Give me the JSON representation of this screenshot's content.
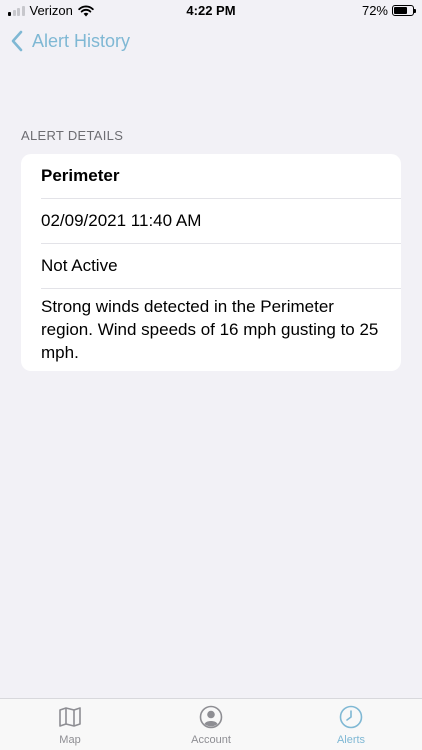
{
  "status_bar": {
    "carrier": "Verizon",
    "time": "4:22 PM",
    "battery_percent": "72%",
    "battery_level": 0.72,
    "signal_bars_active": 1,
    "signal_bars_total": 4
  },
  "nav": {
    "back_label": "Alert History",
    "back_icon": "chevron-left-icon"
  },
  "section": {
    "header": "ALERT DETAILS"
  },
  "alert": {
    "name": "Perimeter",
    "datetime": "02/09/2021 11:40 AM",
    "status": "Not Active",
    "description": "Strong winds detected in the Perimeter region. Wind speeds of 16 mph gusting to 25 mph."
  },
  "tabs": [
    {
      "label": "Map",
      "icon": "map-icon",
      "active": false
    },
    {
      "label": "Account",
      "icon": "account-icon",
      "active": false
    },
    {
      "label": "Alerts",
      "icon": "clock-icon",
      "active": true
    }
  ],
  "colors": {
    "accent": "#7fb8d4",
    "background": "#f2f1f6",
    "inactive_tab": "#8e8e93"
  }
}
